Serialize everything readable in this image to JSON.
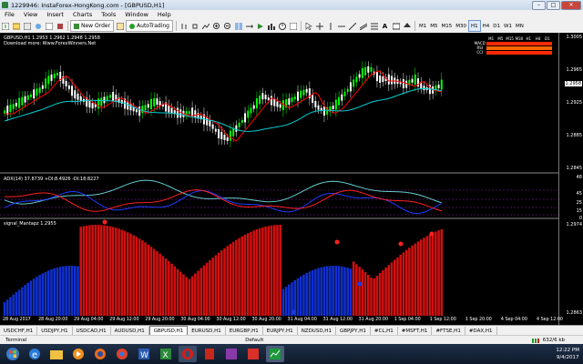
{
  "window": {
    "title": "1229946: InstaForex-HongKong.com - [GBPUSD,H1]"
  },
  "menu": [
    "File",
    "View",
    "Insert",
    "Charts",
    "Tools",
    "Window",
    "Help"
  ],
  "toolbar": {
    "new_order": "New Order",
    "autotrading": "AutoTrading"
  },
  "timeframes": [
    "M1",
    "M5",
    "M15",
    "M30",
    "H1",
    "H4",
    "D1",
    "W1",
    "MN"
  ],
  "active_timeframe": "H1",
  "main_chart": {
    "header": "GBPUSD,H1  1.2953 1.2962 1.2948 1.2958",
    "subheader": "Download more: Www.ForexWinners.Net",
    "price_labels": [
      "1.3005",
      "1.2965",
      "1.2925",
      "1.2885",
      "1.2845"
    ],
    "current_price": "1.2958"
  },
  "adx": {
    "header": "ADX(14) 37.8739  +DI:8.4926  -DI:18.8227",
    "levels": [
      "48",
      "45",
      "25",
      "15",
      "0"
    ]
  },
  "signal": {
    "header": "signal_Mantapz 1.2955",
    "top_label": "1.2974",
    "bottom_label": "1.2863"
  },
  "legend": {
    "periods": [
      "M1",
      "M5",
      "M15",
      "M30",
      "H1",
      "H4",
      "D1",
      "W1",
      "MN"
    ],
    "rows": [
      "MACD",
      "RSI",
      "CCI"
    ]
  },
  "xaxis": [
    "28 Aug 2017",
    "28 Aug 20:00",
    "29 Aug 04:00",
    "29 Aug 12:00",
    "29 Aug 20:00",
    "30 Aug 04:00",
    "30 Aug 12:00",
    "30 Aug 20:00",
    "31 Aug 04:00",
    "31 Aug 12:00",
    "31 Aug 20:00",
    "1 Sep 04:00",
    "1 Sep 12:00",
    "1 Sep 20:00",
    "4 Sep 04:00",
    "4 Sep 12:00"
  ],
  "symbol_tabs": [
    "USDCHF,H1",
    "USDJPY,H1",
    "USDCAD,H1",
    "AUDUSD,H1",
    "GBPUSD,H1",
    "EURUSD,H1",
    "EURGBP,H1",
    "EURJPY,H1",
    "NZDUSD,H1",
    "GBPJPY,H1",
    "#CL,H1",
    "#MSFT,H1",
    "#FTSE,H1",
    "#DAX,H1"
  ],
  "active_symbol_tab": "GBPUSD,H1",
  "status": {
    "terminal": "Terminal",
    "profile": "Default",
    "traffic": "632/6 kb"
  },
  "clock": {
    "time": "12:22 PM",
    "date": "9/4/2017"
  },
  "colors": {
    "bull": "#00ff00",
    "bear": "#ffffff",
    "ma_fast": "#ff0000",
    "ma_slow": "#00ced1",
    "adx_line": "#66cdcd",
    "plus_di": "#1e3cff",
    "minus_di": "#ff2020",
    "hist_red": "#d01010",
    "hist_blue": "#1030d0"
  }
}
